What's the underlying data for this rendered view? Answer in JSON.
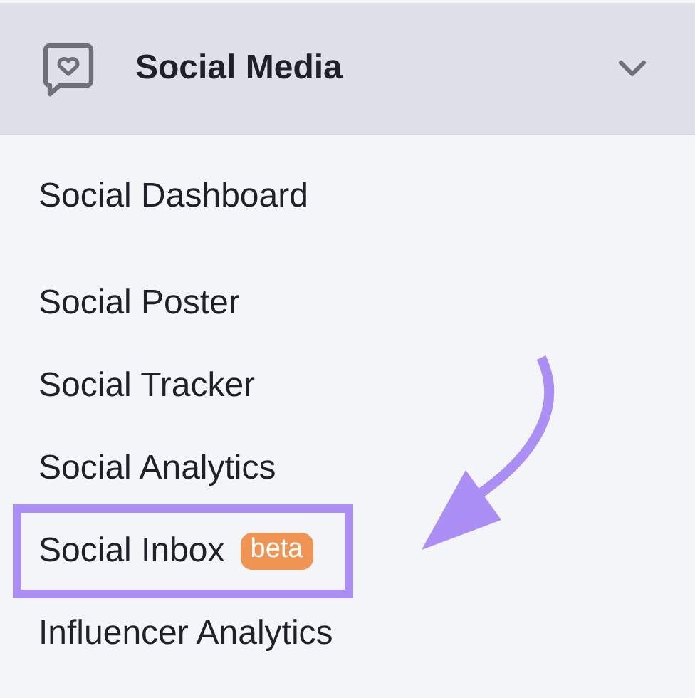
{
  "section": {
    "title": "Social Media",
    "expanded": true
  },
  "groups": [
    [
      {
        "label": "Social Dashboard",
        "highlighted": false
      }
    ],
    [
      {
        "label": "Social Poster",
        "highlighted": false
      },
      {
        "label": "Social Tracker",
        "highlighted": false
      },
      {
        "label": "Social Analytics",
        "highlighted": false
      },
      {
        "label": "Social Inbox",
        "badge": "beta",
        "highlighted": true
      },
      {
        "label": "Influencer Analytics",
        "highlighted": false
      }
    ]
  ]
}
